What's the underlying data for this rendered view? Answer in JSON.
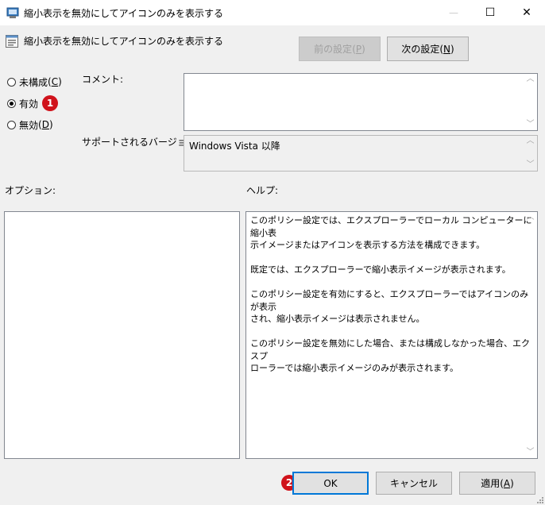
{
  "window": {
    "title": "縮小表示を無効にしてアイコンのみを表示する",
    "minimize_glyph": "—",
    "maximize_glyph": "☐",
    "close_glyph": "✕"
  },
  "header": {
    "policy_name": "縮小表示を無効にしてアイコンのみを表示する",
    "prev_setting_label": "前の設定",
    "prev_setting_key": "P",
    "next_setting_label": "次の設定",
    "next_setting_key": "N"
  },
  "state_options": [
    {
      "label": "未構成",
      "key": "C",
      "checked": false
    },
    {
      "label": "有効",
      "key": "",
      "checked": true
    },
    {
      "label": "無効",
      "key": "D",
      "checked": false
    }
  ],
  "comment": {
    "label": "コメント:",
    "value": ""
  },
  "supported": {
    "label": "サポートされるバージョン:",
    "value": "Windows Vista 以降"
  },
  "options": {
    "label": "オプション:"
  },
  "help": {
    "label": "ヘルプ:",
    "text": "このポリシー設定では、エクスプローラーでローカル コンピューターに縮小表\n示イメージまたはアイコンを表示する方法を構成できます。\n\n既定では、エクスプローラーで縮小表示イメージが表示されます。\n\nこのポリシー設定を有効にすると、エクスプローラーではアイコンのみが表示\nされ、縮小表示イメージは表示されません。\n\nこのポリシー設定を無効にした場合、または構成しなかった場合、エクスプ\nローラーでは縮小表示イメージのみが表示されます。"
  },
  "footer": {
    "ok_label": "OK",
    "cancel_label": "キャンセル",
    "apply_label": "適用",
    "apply_key": "A"
  },
  "annotations": {
    "badge1": "1",
    "badge2": "2"
  },
  "colors": {
    "badge": "#d0121b",
    "focus_border": "#0078d7"
  }
}
